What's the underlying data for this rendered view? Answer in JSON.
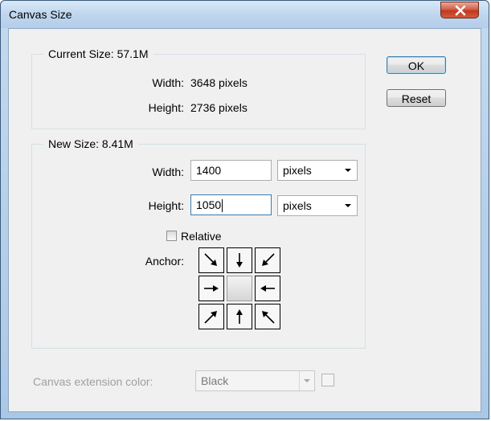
{
  "window": {
    "title": "Canvas Size",
    "colors": {
      "title_bar": "#c6dbf1",
      "close_button": "#c8432b",
      "client_bg": "#f0f0f0"
    }
  },
  "current_size": {
    "legend": "Current Size: 57.1M",
    "width_label": "Width:",
    "width_value": "3648 pixels",
    "height_label": "Height:",
    "height_value": "2736 pixels"
  },
  "new_size": {
    "legend": "New Size: 8.41M",
    "width_label": "Width:",
    "width_value": "1400",
    "width_unit": "pixels",
    "height_label": "Height:",
    "height_value": "1050",
    "height_unit": "pixels",
    "relative_label": "Relative",
    "relative_checked": false,
    "anchor_label": "Anchor:",
    "anchor_selected": "center",
    "anchor_icons": [
      "arrow-up-left-icon",
      "arrow-up-icon",
      "arrow-up-right-icon",
      "arrow-left-icon",
      "anchor-center",
      "arrow-right-icon",
      "arrow-down-left-icon",
      "arrow-down-icon",
      "arrow-down-right-icon"
    ]
  },
  "buttons": {
    "ok": "OK",
    "reset": "Reset"
  },
  "extension": {
    "label": "Canvas extension color:",
    "value": "Black",
    "enabled": false
  }
}
